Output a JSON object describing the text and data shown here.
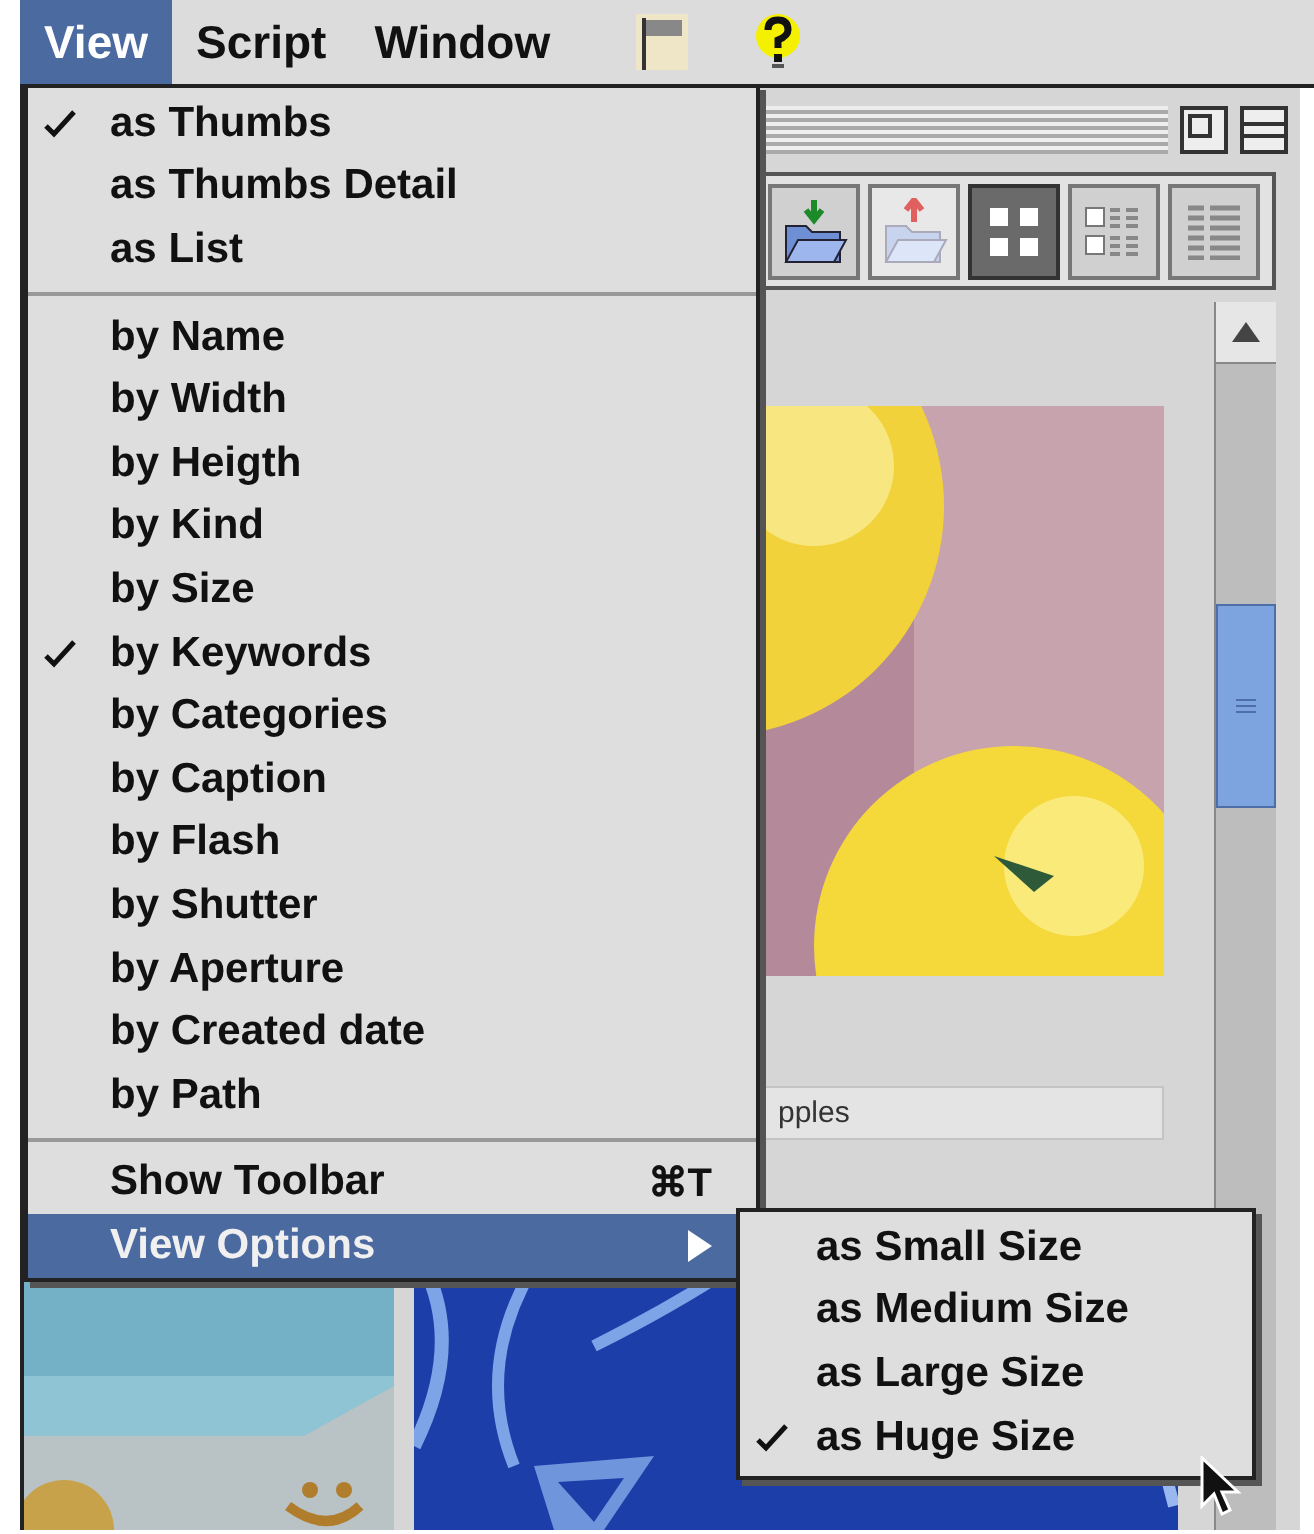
{
  "menubar": [
    {
      "label": "View",
      "selected": true
    },
    {
      "label": "Script",
      "selected": false
    },
    {
      "label": "Window",
      "selected": false
    }
  ],
  "menu": {
    "sections": [
      [
        {
          "label": "as Thumbs",
          "checked": true,
          "selected": false,
          "kind": "command"
        },
        {
          "label": "as Thumbs Detail",
          "checked": false,
          "selected": false,
          "kind": "command"
        },
        {
          "label": "as List",
          "checked": false,
          "selected": false,
          "kind": "command"
        }
      ],
      [
        {
          "label": "by Name",
          "checked": false,
          "selected": false,
          "kind": "command"
        },
        {
          "label": "by Width",
          "checked": false,
          "selected": false,
          "kind": "command"
        },
        {
          "label": "by Heigth",
          "checked": false,
          "selected": false,
          "kind": "command"
        },
        {
          "label": "by Kind",
          "checked": false,
          "selected": false,
          "kind": "command"
        },
        {
          "label": "by Size",
          "checked": false,
          "selected": false,
          "kind": "command"
        },
        {
          "label": "by Keywords",
          "checked": true,
          "selected": false,
          "kind": "command"
        },
        {
          "label": "by Categories",
          "checked": false,
          "selected": false,
          "kind": "command"
        },
        {
          "label": "by Caption",
          "checked": false,
          "selected": false,
          "kind": "command"
        },
        {
          "label": "by Flash",
          "checked": false,
          "selected": false,
          "kind": "command"
        },
        {
          "label": "by Shutter",
          "checked": false,
          "selected": false,
          "kind": "command"
        },
        {
          "label": "by Aperture",
          "checked": false,
          "selected": false,
          "kind": "command"
        },
        {
          "label": "by Created date",
          "checked": false,
          "selected": false,
          "kind": "command"
        },
        {
          "label": "by Path",
          "checked": false,
          "selected": false,
          "kind": "command"
        }
      ],
      [
        {
          "label": "Show Toolbar",
          "checked": false,
          "selected": false,
          "kind": "command",
          "shortcut": "⌘T"
        },
        {
          "label": "View Options",
          "checked": false,
          "selected": true,
          "kind": "submenu"
        }
      ]
    ]
  },
  "submenu": [
    {
      "label": "as Small Size",
      "checked": false
    },
    {
      "label": "as Medium Size",
      "checked": false
    },
    {
      "label": "as Large Size",
      "checked": false
    },
    {
      "label": "as Huge Size",
      "checked": true
    }
  ],
  "toolbar": [
    {
      "kind": "import",
      "selected": false,
      "disabled": false
    },
    {
      "kind": "export",
      "selected": false,
      "disabled": true
    },
    {
      "kind": "thumbs",
      "selected": true,
      "disabled": false
    },
    {
      "kind": "detail",
      "selected": false,
      "disabled": false
    },
    {
      "kind": "list",
      "selected": false,
      "disabled": false
    }
  ],
  "thumbnails": [
    {
      "kind": "picture",
      "caption": "pples"
    }
  ]
}
